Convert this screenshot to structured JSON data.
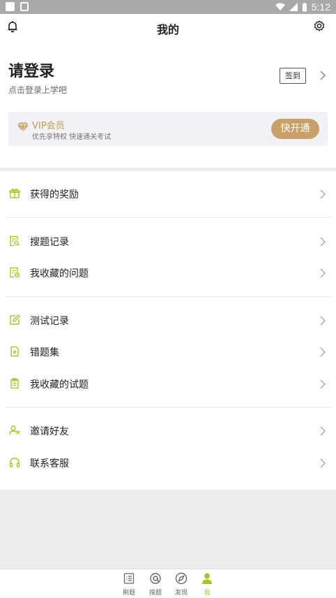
{
  "status_bar": {
    "time": "5:12"
  },
  "header": {
    "title": "我的"
  },
  "profile": {
    "login_title": "请登录",
    "login_subtitle": "点击登录上学吧",
    "signin_label": "签到"
  },
  "vip": {
    "title": "VIP会员",
    "subtitle": "优先享特权 快速通关考试",
    "button_label": "快开通"
  },
  "menu": {
    "rewards": "获得的奖励",
    "search_history": "搜题记录",
    "favorite_questions": "我收藏的问题",
    "test_history": "测试记录",
    "wrong_questions": "错题集",
    "favorite_tests": "我收藏的试题",
    "invite_friends": "邀请好友",
    "contact_service": "联系客服"
  },
  "tabs": [
    {
      "label": "刷题",
      "icon": "list-icon"
    },
    {
      "label": "搜题",
      "icon": "search-at-icon"
    },
    {
      "label": "发现",
      "icon": "compass-icon"
    },
    {
      "label": "我",
      "icon": "person-icon",
      "active": true
    }
  ],
  "colors": {
    "accent": "#a8c52c",
    "vip_gold": "#c9a06a",
    "vip_text": "#c49a5e"
  }
}
